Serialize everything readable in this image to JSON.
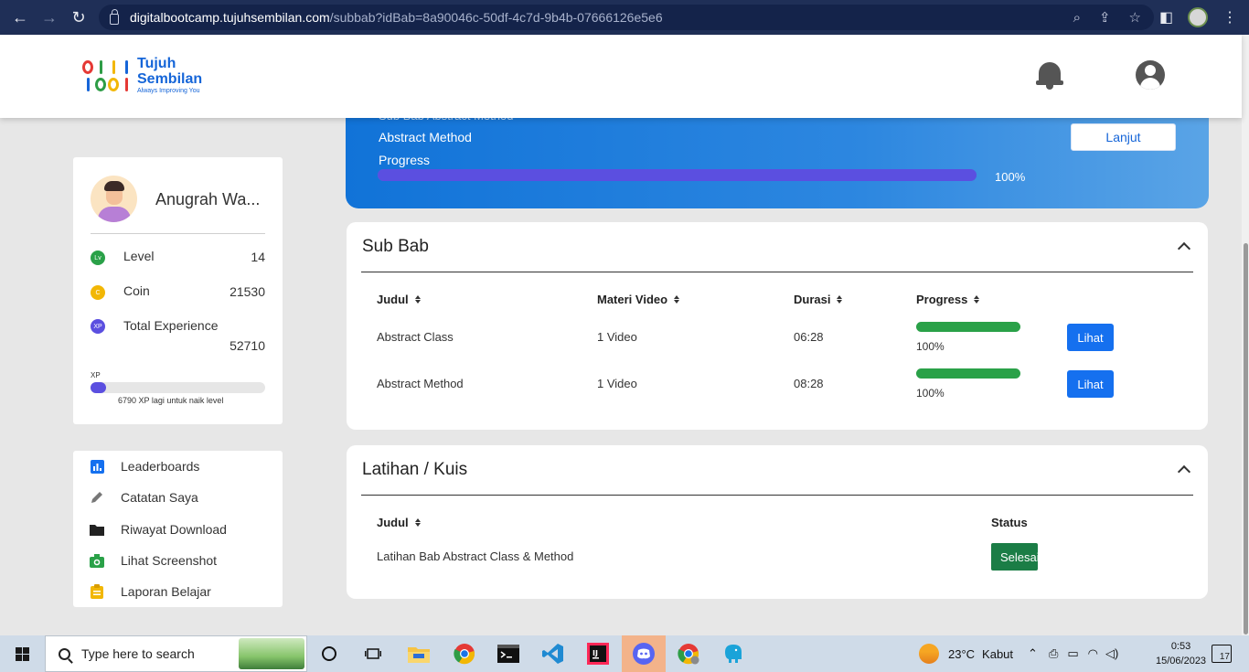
{
  "browser": {
    "url_host": "digitalbootcamp.tujuhsembilan.com",
    "url_path": "/subbab?idBab=8a90046c-50df-4c7d-9b4b-07666126e5e6"
  },
  "brand": {
    "line1": "Tujuh",
    "line2": "Sembilan",
    "tagline": "Always Improving You",
    "colors": {
      "primary": "#1565d8",
      "red": "#e53935",
      "green": "#2e9d46",
      "yellow": "#f2b705",
      "blue": "#1565d8"
    }
  },
  "banner": {
    "cut_text": "Sub Bab Abstract Method",
    "subtitle": "Abstract Method",
    "progress_label": "Progress",
    "progress_value": "100%",
    "progress_fraction": 1.0,
    "button_label": "Lanjut"
  },
  "profile": {
    "name": "Anugrah Wa...",
    "level_label": "Level",
    "level_icon": "Lv",
    "level_value": "14",
    "coin_label": "Coin",
    "coin_icon": "C",
    "coin_value": "21530",
    "xp_label": "Total Experience",
    "xp_icon": "XP",
    "xp_value": "52710",
    "xp_bar_label": "XP",
    "xp_bar_fraction": 0.09,
    "xp_note": "6790 XP lagi untuk naik level"
  },
  "menu": {
    "items": [
      {
        "label": "Leaderboards",
        "icon": "bar-chart-icon"
      },
      {
        "label": "Catatan Saya",
        "icon": "pencil-icon"
      },
      {
        "label": "Riwayat Download",
        "icon": "folder-icon"
      },
      {
        "label": "Lihat Screenshot",
        "icon": "camera-icon"
      },
      {
        "label": "Laporan Belajar",
        "icon": "clipboard-icon"
      }
    ]
  },
  "subbab": {
    "title": "Sub Bab",
    "columns": [
      "Judul",
      "Materi Video",
      "Durasi",
      "Progress"
    ],
    "rows": [
      {
        "judul": "Abstract Class",
        "materi": "1 Video",
        "durasi": "06:28",
        "progress": "100%",
        "progress_fraction": 1.0,
        "action": "Lihat"
      },
      {
        "judul": "Abstract Method",
        "materi": "1 Video",
        "durasi": "08:28",
        "progress": "100%",
        "progress_fraction": 1.0,
        "action": "Lihat"
      }
    ]
  },
  "latihan": {
    "title": "Latihan / Kuis",
    "col_judul": "Judul",
    "col_status": "Status",
    "rows": [
      {
        "judul": "Latihan Bab Abstract Class & Method",
        "status": "Selesai"
      }
    ]
  },
  "taskbar": {
    "search_placeholder": "Type here to search",
    "weather": "23°C",
    "weather_desc": "Kabut",
    "time": "0:53",
    "date": "15/06/2023",
    "notifications": "17"
  }
}
